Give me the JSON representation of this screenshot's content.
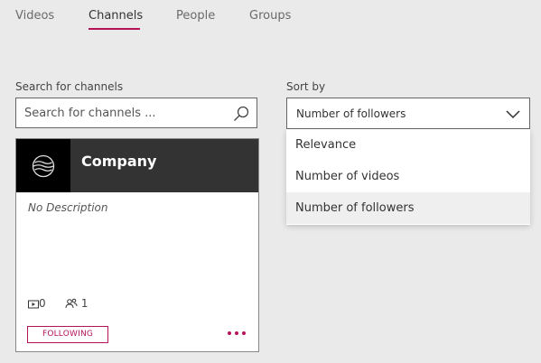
{
  "tabs": [
    {
      "label": "Videos",
      "active": false
    },
    {
      "label": "Channels",
      "active": true
    },
    {
      "label": "People",
      "active": false
    },
    {
      "label": "Groups",
      "active": false
    }
  ],
  "search": {
    "label": "Search for channels",
    "placeholder": "Search for channels ...",
    "value": ""
  },
  "sort": {
    "label": "Sort by",
    "selected": "Number of followers",
    "options": [
      "Relevance",
      "Number of videos",
      "Number of followers"
    ]
  },
  "channel_card": {
    "title": "Company",
    "description": "No Description",
    "video_count": "0",
    "follower_count": "1",
    "follow_label": "FOLLOWING"
  },
  "icons": {
    "search": "search-icon",
    "chevron": "chevron-down-icon",
    "logo": "waves-logo-icon",
    "videos": "video-icon",
    "followers": "followers-icon",
    "more": "more-icon"
  },
  "colors": {
    "accent": "#b5125a",
    "background": "#eaeaea",
    "card_header": "#333333"
  }
}
